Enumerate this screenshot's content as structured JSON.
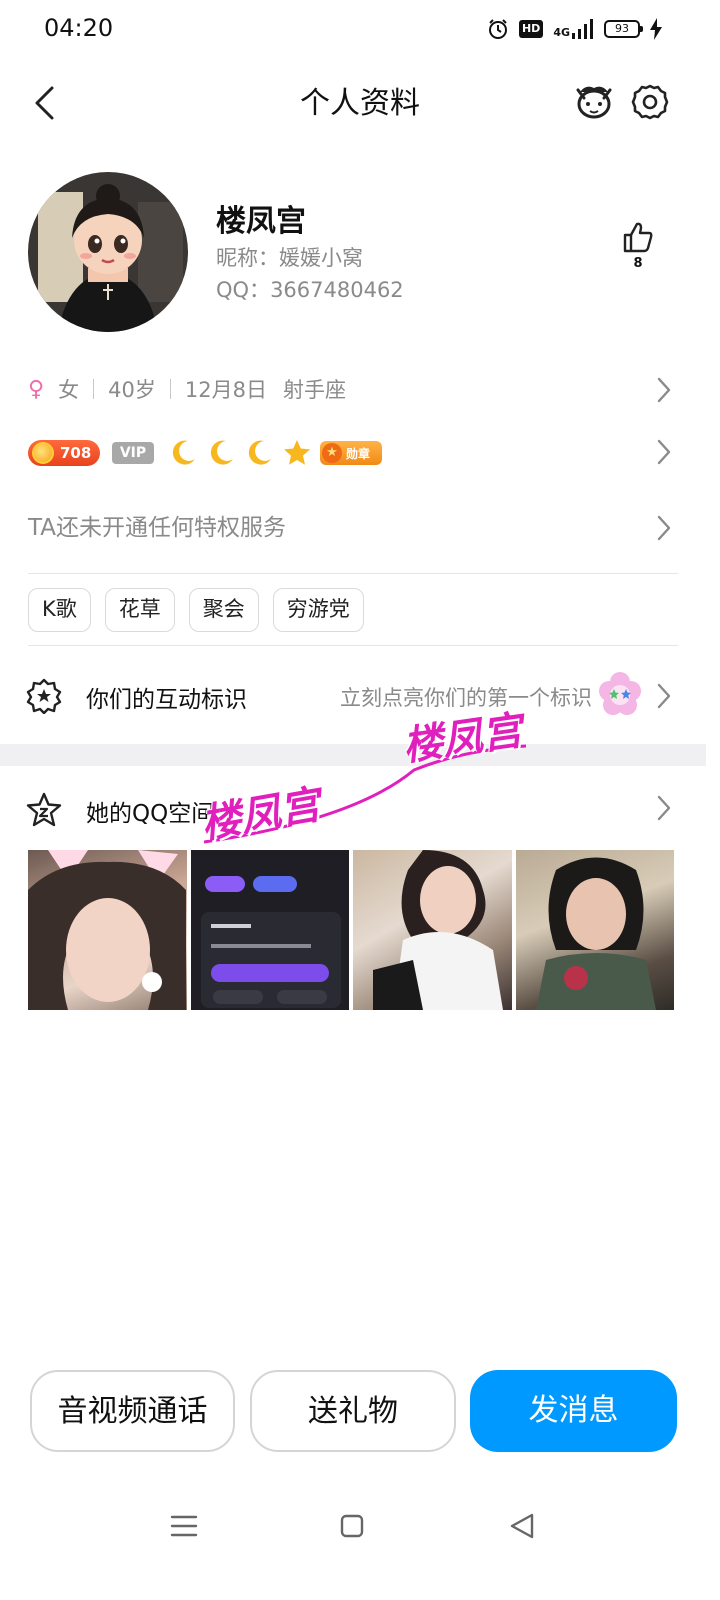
{
  "status_bar": {
    "time": "04:20",
    "hd_label": "HD",
    "network_label": "4G",
    "battery_level": "93"
  },
  "header": {
    "title": "个人资料",
    "icons": [
      "back-arrow-icon",
      "cat-face-icon",
      "gear-icon"
    ]
  },
  "profile": {
    "name": "楼凤宫",
    "nickname_label": "昵称：",
    "nickname": "媛媛小窝",
    "qq_label": "QQ：",
    "qq_number": "3667480462",
    "likes": "8"
  },
  "info": {
    "gender": "女",
    "age": "40岁",
    "birthday": "12月8日",
    "zodiac": "射手座"
  },
  "badges": {
    "level_value": "708",
    "vip_label": "VIP",
    "moons": 3,
    "stars": 1,
    "medal_label": "勋章"
  },
  "privilege": {
    "text": "TA还未开通任何特权服务"
  },
  "tags": [
    "K歌",
    "花草",
    "聚会",
    "穷游党"
  ],
  "interaction": {
    "label": "你们的互动标识",
    "hint": "立刻点亮你们的第一个标识"
  },
  "qzone": {
    "label": "她的QQ空间",
    "photo_count": 4
  },
  "watermark": {
    "text": "楼凤宫"
  },
  "actions": {
    "call": "音视频通话",
    "gift": "送礼物",
    "message": "发消息"
  },
  "colors": {
    "accent": "#0099ff",
    "female": "#f06eaa",
    "watermark": "#e01fbd",
    "muted_text": "#8a8a8a"
  }
}
